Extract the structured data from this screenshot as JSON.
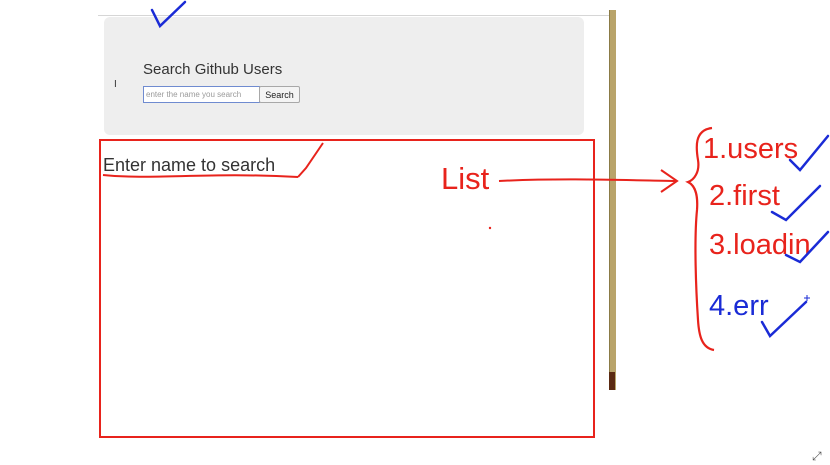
{
  "header": {
    "title": "Search Github Users"
  },
  "search": {
    "placeholder": "enter the name you search",
    "value": "",
    "button_label": "Search"
  },
  "list": {
    "empty_message": "Enter name to search"
  },
  "annotations": {
    "list_label": "List",
    "items": [
      "1.users",
      "2.first",
      "3.loadin",
      "4.err"
    ],
    "colors": {
      "red": "#e8231c",
      "blue": "#1a2bd6"
    }
  },
  "icons": {
    "cursor": "text-cursor-icon",
    "resize": "resize-icon"
  }
}
